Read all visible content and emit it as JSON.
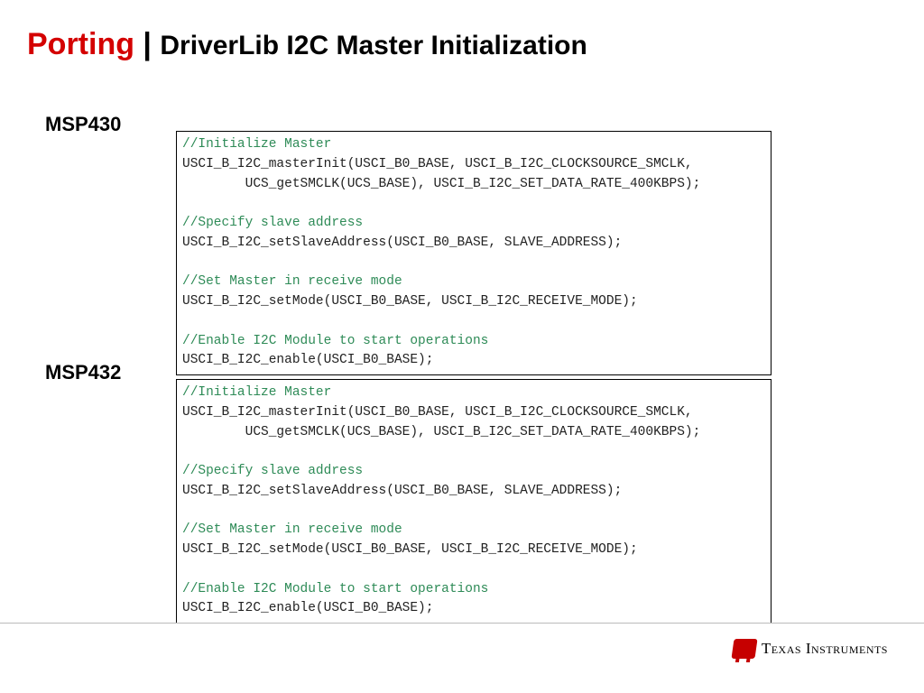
{
  "title": {
    "red": "Porting",
    "sep": " | ",
    "black": "DriverLib I2C Master Initialization"
  },
  "labels": {
    "msp430": "MSP430",
    "msp432": "MSP432"
  },
  "code430": {
    "c1": "//Initialize Master",
    "l1": "USCI_B_I2C_masterInit(USCI_B0_BASE, USCI_B_I2C_CLOCKSOURCE_SMCLK,",
    "l2": "        UCS_getSMCLK(UCS_BASE), USCI_B_I2C_SET_DATA_RATE_400KBPS);",
    "c2": "//Specify slave address",
    "l3": "USCI_B_I2C_setSlaveAddress(USCI_B0_BASE, SLAVE_ADDRESS);",
    "c3": "//Set Master in receive mode",
    "l4": "USCI_B_I2C_setMode(USCI_B0_BASE, USCI_B_I2C_RECEIVE_MODE);",
    "c4": "//Enable I2C Module to start operations",
    "l5": "USCI_B_I2C_enable(USCI_B0_BASE);"
  },
  "code432": {
    "c1": "//Initialize Master",
    "l1": "USCI_B_I2C_masterInit(USCI_B0_BASE, USCI_B_I2C_CLOCKSOURCE_SMCLK,",
    "l2": "        UCS_getSMCLK(UCS_BASE), USCI_B_I2C_SET_DATA_RATE_400KBPS);",
    "c2": "//Specify slave address",
    "l3": "USCI_B_I2C_setSlaveAddress(USCI_B0_BASE, SLAVE_ADDRESS);",
    "c3": "//Set Master in receive mode",
    "l4": "USCI_B_I2C_setMode(USCI_B0_BASE, USCI_B_I2C_RECEIVE_MODE);",
    "c4": "//Enable I2C Module to start operations",
    "l5": "USCI_B_I2C_enable(USCI_B0_BASE);"
  },
  "footer": {
    "brand": "Texas Instruments"
  }
}
